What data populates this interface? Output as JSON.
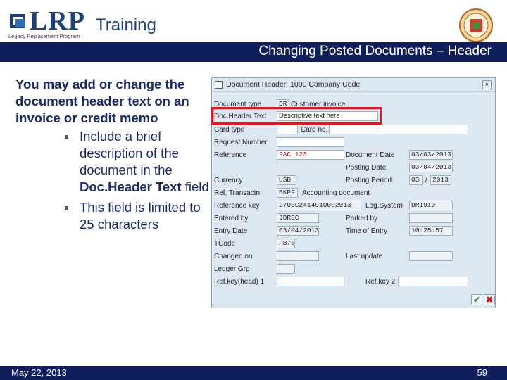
{
  "header": {
    "logo_text": "LRP",
    "logo_tagline": "Legacy Replacement Program",
    "training": "Training",
    "slide_title": "Changing Posted Documents – Header"
  },
  "content": {
    "intro": "You may add or change the document header text on an invoice or credit memo",
    "bullets": [
      {
        "text_before": "Include a brief description of the document in the ",
        "bold": "Doc.Header Text",
        "text_after": " field"
      },
      {
        "text_before": "This field is limited to 25 characters",
        "bold": "",
        "text_after": ""
      }
    ]
  },
  "dialog": {
    "title": "Document Header: 1000 Company Code",
    "close_icon": "close-icon",
    "fields": {
      "document_type": {
        "label": "Document type",
        "code": "DR",
        "desc": "Customer invoice"
      },
      "doc_header_text": {
        "label": "Doc.Header Text",
        "value": "Descriptive text here"
      },
      "card_type": {
        "label": "Card type",
        "value": "",
        "card_no_label": "Card no.",
        "card_no_value": ""
      },
      "request_number": {
        "label": "Request Number",
        "value": ""
      },
      "reference": {
        "label": "Reference",
        "value": "FAC 123"
      },
      "document_date": {
        "label": "Document Date",
        "value": "03/03/2013"
      },
      "posting_date": {
        "label": "Posting Date",
        "value": "03/04/2013"
      },
      "currency": {
        "label": "Currency",
        "value": "USD"
      },
      "posting_period": {
        "label": "Posting Period",
        "period": "03",
        "year": "2013"
      },
      "ref_transactn": {
        "label": "Ref. Transactn",
        "value": "BKPF",
        "desc": "Accounting document"
      },
      "reference_key": {
        "label": "Reference key",
        "value": "2700C2414910002013"
      },
      "log_system": {
        "label": "Log.System",
        "value": "DR1910"
      },
      "entered_by": {
        "label": "Entered by",
        "value": "JDREC"
      },
      "parked_by": {
        "label": "Parked by",
        "value": ""
      },
      "entry_date": {
        "label": "Entry Date",
        "value": "03/04/2013"
      },
      "time_of_entry": {
        "label": "Time of Entry",
        "value": "10:25:57"
      },
      "tcode": {
        "label": "TCode",
        "value": "FB70"
      },
      "changed_on": {
        "label": "Changed on",
        "value": ""
      },
      "last_update": {
        "label": "Last update",
        "value": ""
      },
      "ledger_grp": {
        "label": "Ledger Grp",
        "value": ""
      },
      "ref_key_head1": {
        "label": "Ref.key(head) 1",
        "value": ""
      },
      "ref_key_2": {
        "label": "Ref.key 2",
        "value": ""
      }
    },
    "buttons": {
      "ok_icon": "checkmark-icon",
      "cancel_icon": "cancel-x-icon"
    }
  },
  "footer": {
    "date": "May 22, 2013",
    "page": "59"
  },
  "colors": {
    "navy": "#0f1f5c",
    "highlight": "#e0191f",
    "text_blue": "#1a2a6c"
  }
}
